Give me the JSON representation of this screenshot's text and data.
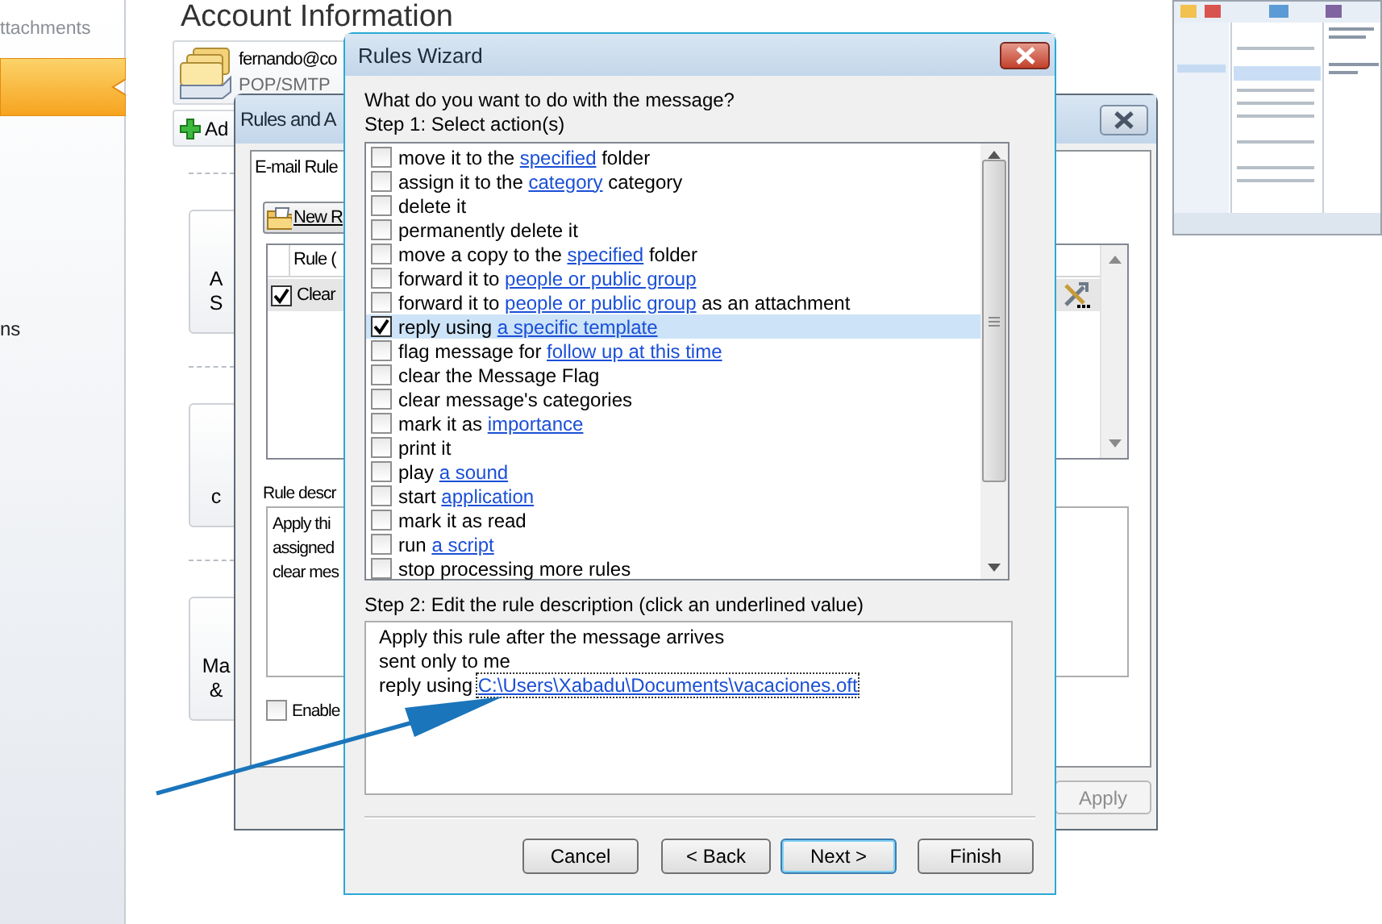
{
  "sidebar": {
    "items": [
      {
        "label": "ttachments",
        "selected": false
      },
      {
        "selected": true
      },
      {
        "label": "ns",
        "selected": false
      }
    ]
  },
  "account_info": {
    "title": "Account Information",
    "account": {
      "email": "fernando@co",
      "type": "POP/SMTP"
    },
    "add_button": "Ad",
    "tiles": [
      {
        "lines": [
          "A",
          "S"
        ]
      },
      {
        "lines": [
          "c"
        ]
      },
      {
        "lines": [
          "Ma",
          "&"
        ]
      }
    ]
  },
  "rules_dialog": {
    "title": "Rules and A",
    "tab": "E-mail Rule",
    "new_rule_button": "New R",
    "columns": [
      "Rule ("
    ],
    "rows": [
      {
        "name": "Clear",
        "checked": true,
        "selected": true
      }
    ],
    "description_label": "Rule descr",
    "description_lines": [
      "Apply thi",
      "assigned",
      "clear mes"
    ],
    "enable_checkbox": {
      "label": "Enable",
      "checked": false
    },
    "apply_button": {
      "label": "Apply",
      "disabled": true
    }
  },
  "wizard": {
    "title": "Rules Wizard",
    "question": "What do you want to do with the message?",
    "step1_label": "Step 1: Select action(s)",
    "actions": [
      {
        "parts": [
          "move it to the ",
          {
            "link": "specified"
          },
          " folder"
        ],
        "checked": false,
        "selected": false
      },
      {
        "parts": [
          "assign it to the ",
          {
            "link": "category"
          },
          " category"
        ],
        "checked": false,
        "selected": false
      },
      {
        "parts": [
          "delete it"
        ],
        "checked": false,
        "selected": false
      },
      {
        "parts": [
          "permanently delete it"
        ],
        "checked": false,
        "selected": false
      },
      {
        "parts": [
          "move a copy to the ",
          {
            "link": "specified"
          },
          " folder"
        ],
        "checked": false,
        "selected": false
      },
      {
        "parts": [
          "forward it to ",
          {
            "link": "people or public group"
          }
        ],
        "checked": false,
        "selected": false
      },
      {
        "parts": [
          "forward it to ",
          {
            "link": "people or public group"
          },
          " as an attachment"
        ],
        "checked": false,
        "selected": false
      },
      {
        "parts": [
          "reply using ",
          {
            "link": "a specific template"
          }
        ],
        "checked": true,
        "selected": true
      },
      {
        "parts": [
          "flag message for ",
          {
            "link": "follow up at this time"
          }
        ],
        "checked": false,
        "selected": false
      },
      {
        "parts": [
          "clear the Message Flag"
        ],
        "checked": false,
        "selected": false
      },
      {
        "parts": [
          "clear message's categories"
        ],
        "checked": false,
        "selected": false
      },
      {
        "parts": [
          "mark it as ",
          {
            "link": "importance"
          }
        ],
        "checked": false,
        "selected": false
      },
      {
        "parts": [
          "print it"
        ],
        "checked": false,
        "selected": false
      },
      {
        "parts": [
          "play ",
          {
            "link": "a sound"
          }
        ],
        "checked": false,
        "selected": false
      },
      {
        "parts": [
          "start ",
          {
            "link": "application"
          }
        ],
        "checked": false,
        "selected": false
      },
      {
        "parts": [
          "mark it as read"
        ],
        "checked": false,
        "selected": false
      },
      {
        "parts": [
          "run ",
          {
            "link": "a script"
          }
        ],
        "checked": false,
        "selected": false
      },
      {
        "parts": [
          "stop processing more rules"
        ],
        "checked": false,
        "selected": false
      }
    ],
    "step2_label": "Step 2: Edit the rule description (click an underlined value)",
    "description": [
      {
        "parts": [
          "Apply this rule after the message arrives"
        ]
      },
      {
        "parts": [
          "sent only to me"
        ]
      },
      {
        "parts": [
          "reply using ",
          {
            "link": "C:\\Users\\Xabadu\\Documents\\vacaciones.oft"
          }
        ]
      }
    ],
    "buttons": [
      {
        "label": "Cancel",
        "default": false
      },
      {
        "label": "< Back",
        "default": false
      },
      {
        "label": "Next >",
        "default": true
      },
      {
        "label": "Finish",
        "default": false
      }
    ]
  }
}
